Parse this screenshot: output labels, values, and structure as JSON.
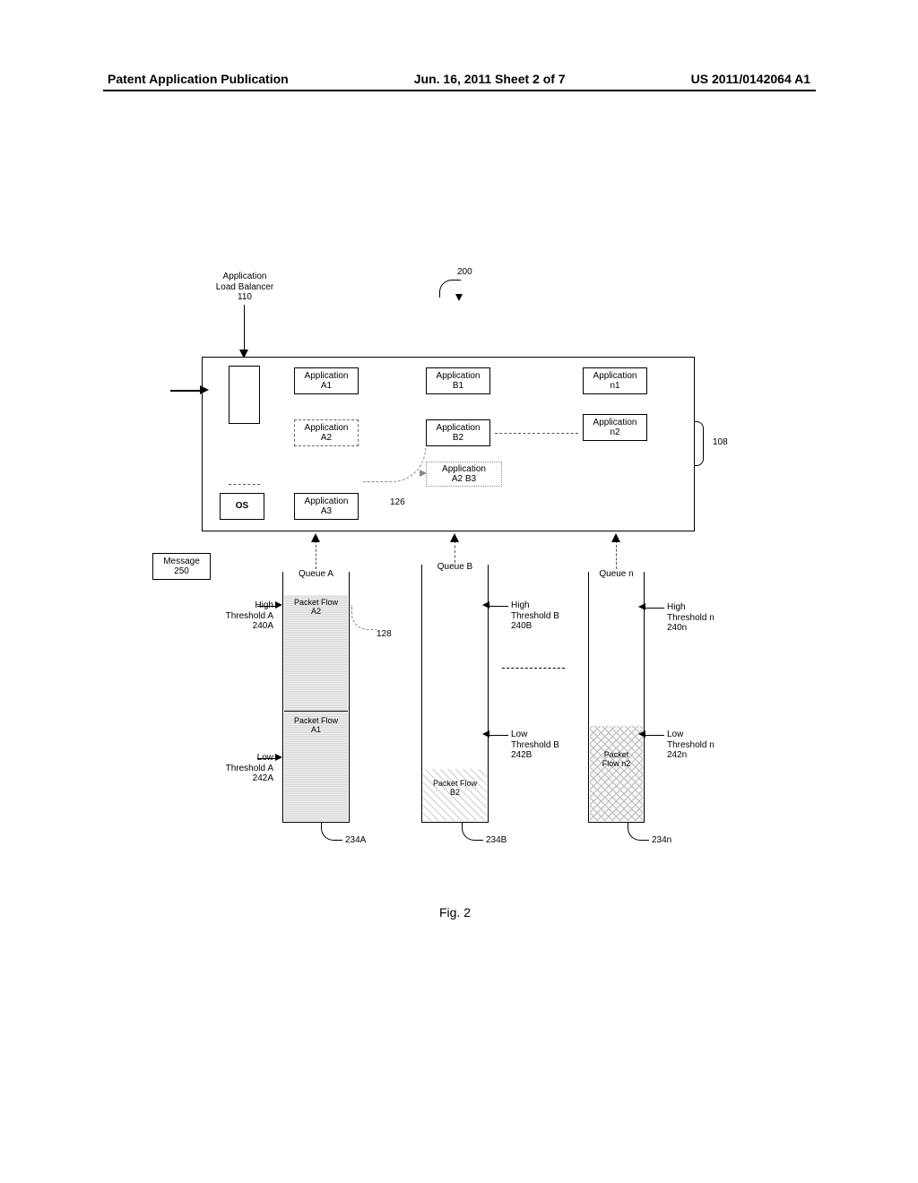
{
  "header": {
    "left": "Patent Application Publication",
    "center": "Jun. 16, 2011  Sheet 2 of 7",
    "right": "US 2011/0142064 A1"
  },
  "diagram_ref": "200",
  "app_load_balancer": {
    "title_line1": "Application",
    "title_line2": "Load Balancer",
    "ref": "110"
  },
  "server_ref": "108",
  "os_label": "OS",
  "apps": {
    "A1": {
      "line1": "Application",
      "line2": "A1"
    },
    "A2": {
      "line1": "Application",
      "line2": "A2"
    },
    "A3": {
      "line1": "Application",
      "line2": "A3"
    },
    "B1": {
      "line1": "Application",
      "line2": "B1"
    },
    "B2": {
      "line1": "Application",
      "line2": "B2"
    },
    "A2B3": {
      "line1": "Application",
      "line2": "A2 B3"
    },
    "n1": {
      "line1": "Application",
      "line2": "n1"
    },
    "n2": {
      "line1": "Application",
      "line2": "n2"
    }
  },
  "ref_126": "126",
  "ref_128": "128",
  "message": {
    "line1": "Message",
    "line2": "250"
  },
  "queues": {
    "A": {
      "title": "Queue A",
      "ref": "234A",
      "pfA2_l1": "Packet Flow",
      "pfA2_l2": "A2",
      "pfA1_l1": "Packet Flow",
      "pfA1_l2": "A1"
    },
    "B": {
      "title": "Queue B",
      "ref": "234B",
      "pfB2_l1": "Packet Flow",
      "pfB2_l2": "B2"
    },
    "n": {
      "title": "Queue n",
      "ref": "234n",
      "pfn2_l1": "Packet",
      "pfn2_l2": "Flow n2"
    }
  },
  "thresholds": {
    "highA": {
      "l1": "High",
      "l2": "Threshold A",
      "l3": "240A"
    },
    "lowA": {
      "l1": "Low",
      "l2": "Threshold A",
      "l3": "242A"
    },
    "highB": {
      "l1": "High",
      "l2": "Threshold B",
      "l3": "240B"
    },
    "lowB": {
      "l1": "Low",
      "l2": "Threshold B",
      "l3": "242B"
    },
    "highn": {
      "l1": "High",
      "l2": "Threshold n",
      "l3": "240n"
    },
    "lown": {
      "l1": "Low",
      "l2": "Threshold n",
      "l3": "242n"
    }
  },
  "fig_caption": "Fig. 2"
}
